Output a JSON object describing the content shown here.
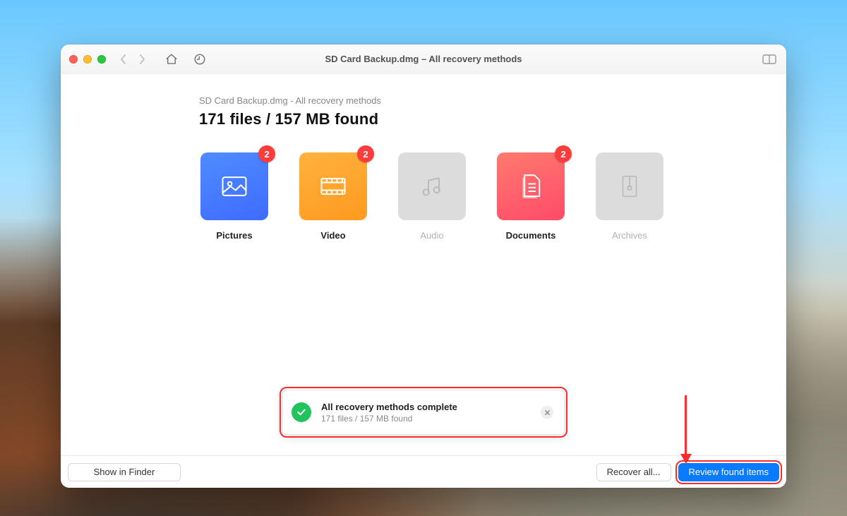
{
  "window": {
    "title": "SD Card Backup.dmg – All recovery methods"
  },
  "header": {
    "subtitle": "SD Card Backup.dmg - All recovery methods",
    "main_line": "171 files / 157 MB found"
  },
  "categories": [
    {
      "key": "pictures",
      "label": "Pictures",
      "badge": "2",
      "enabled": true,
      "icon": "image-icon"
    },
    {
      "key": "video",
      "label": "Video",
      "badge": "2",
      "enabled": true,
      "icon": "video-icon"
    },
    {
      "key": "audio",
      "label": "Audio",
      "badge": null,
      "enabled": false,
      "icon": "audio-icon"
    },
    {
      "key": "documents",
      "label": "Documents",
      "badge": "2",
      "enabled": true,
      "icon": "document-icon"
    },
    {
      "key": "archives",
      "label": "Archives",
      "badge": null,
      "enabled": false,
      "icon": "archive-icon"
    }
  ],
  "toast": {
    "title": "All recovery methods complete",
    "subtitle": "171 files / 157 MB found"
  },
  "footer": {
    "show_in_finder": "Show in Finder",
    "recover_all": "Recover all...",
    "review": "Review found items"
  },
  "colors": {
    "accent": "#0a7aff",
    "badge": "#ff3c3c",
    "success": "#21c35c",
    "annotation": "#ff2a2a"
  }
}
